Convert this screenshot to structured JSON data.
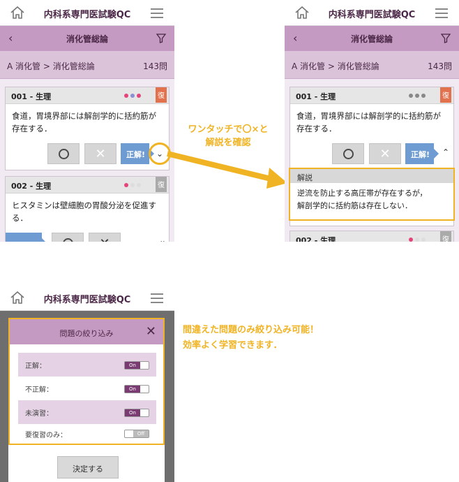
{
  "app": {
    "title": "内科系専門医試験QC"
  },
  "list": {
    "section_title": "消化管総論",
    "breadcrumb": "A 消化管 > 消化管総論",
    "count": "143問"
  },
  "cards": [
    {
      "number": "001 - 生理",
      "text": "食道，胃境界部には解剖学的に括約筋が存在する．",
      "badge": "復"
    },
    {
      "number": "002 - 生理",
      "text": "ヒスタミンは壁細胞の胃酸分泌を促進する．",
      "badge": "復"
    }
  ],
  "answer": {
    "correct_label": "正解!",
    "cross_symbol": "✕"
  },
  "explanation": {
    "title": "解説",
    "line1": "逆流を防止する高圧帯が存在するが，",
    "line2": "解剖学的に括約筋は存在しない．"
  },
  "captions": {
    "one_tap_line1": "ワンタッチで〇×と",
    "one_tap_line2": "解説を確認",
    "filter_line1": "間違えた問題のみ絞り込み可能！",
    "filter_line2": "効率よく学習できます．"
  },
  "filter_dialog": {
    "title": "問題の絞り込み",
    "rows": [
      {
        "label": "正解：",
        "state": "On"
      },
      {
        "label": "不正解：",
        "state": "On"
      },
      {
        "label": "未演習：",
        "state": "On"
      },
      {
        "label": "要復習のみ：",
        "state": "Off"
      }
    ],
    "confirm_label": "決定する"
  },
  "colors": {
    "accent": "#f0b323",
    "header_purple": "#c59ac2",
    "badge_on": "#e2714d",
    "correct_blue": "#6e9cd2"
  }
}
